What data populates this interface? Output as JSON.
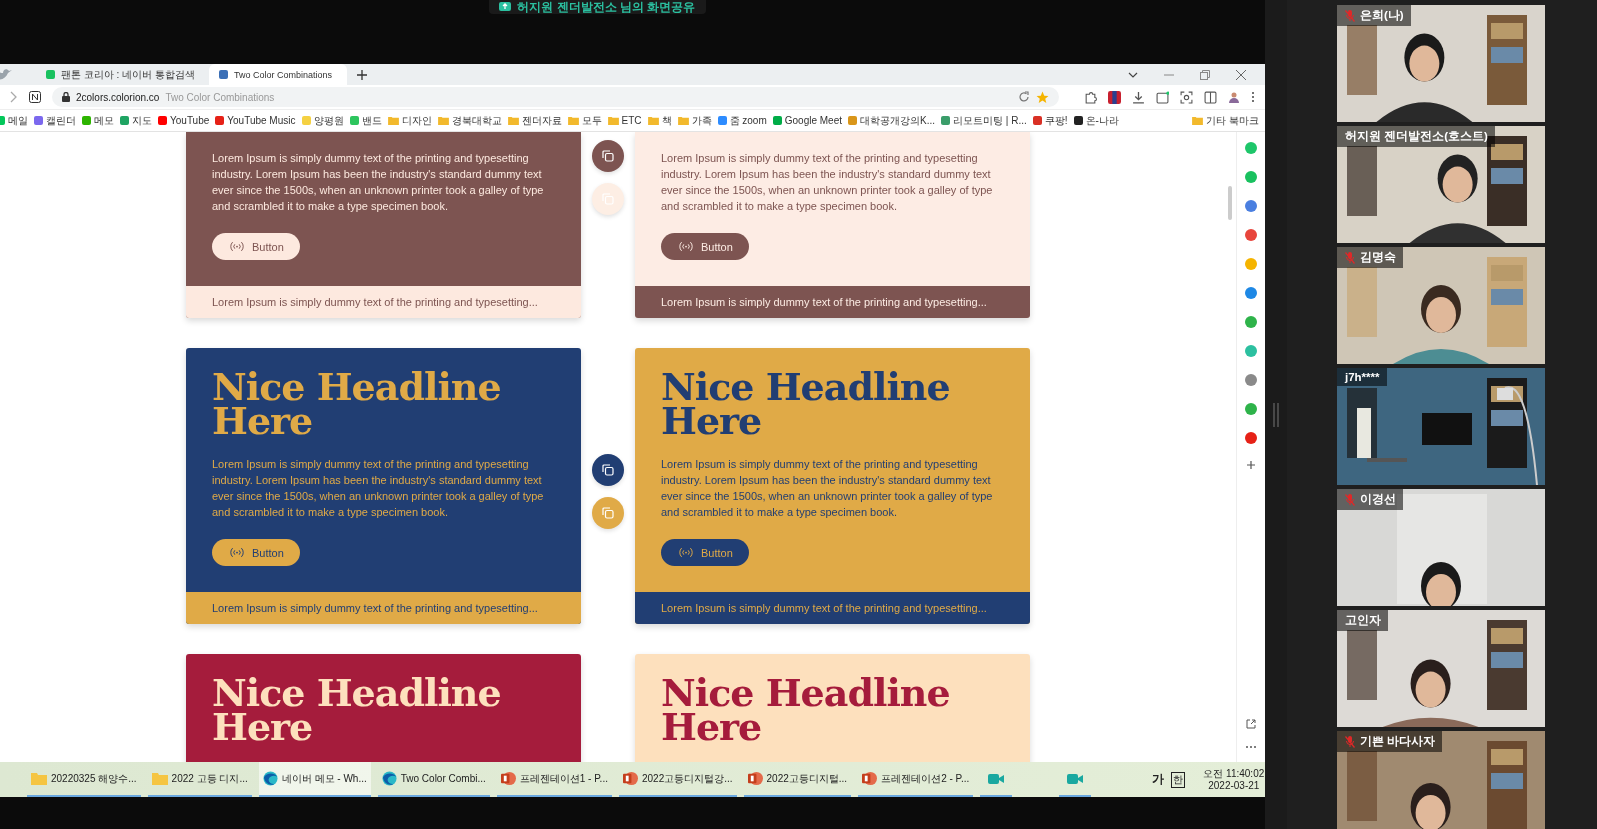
{
  "share_banner": {
    "text": "허지원 젠더발전소 님의 화면공유"
  },
  "browser": {
    "tabs": [
      {
        "title": "팬톤 코리아 : 네이버 통합검색",
        "selected": false,
        "color": "#19c15f"
      },
      {
        "title": "Two Color Combinations",
        "selected": true,
        "color": "#3b6fb6"
      }
    ],
    "address": {
      "domain": "2colors.colorion.co",
      "page_title": "Two Color Combinations"
    },
    "bookmarks": [
      {
        "label": "메일",
        "kind": "site",
        "color": "#03c75a"
      },
      {
        "label": "캘린더",
        "kind": "site",
        "color": "#7b68ee"
      },
      {
        "label": "메모",
        "kind": "site",
        "color": "#2db400"
      },
      {
        "label": "지도",
        "kind": "site",
        "color": "#1fa463"
      },
      {
        "label": "YouTube",
        "kind": "site",
        "color": "#ff0000"
      },
      {
        "label": "YouTube Music",
        "kind": "site",
        "color": "#e62117"
      },
      {
        "label": "양평원",
        "kind": "site",
        "color": "#f5d142"
      },
      {
        "label": "밴드",
        "kind": "site",
        "color": "#2dc55e"
      },
      {
        "label": "디자인",
        "kind": "folder"
      },
      {
        "label": "경북대학교",
        "kind": "folder"
      },
      {
        "label": "젠더자료",
        "kind": "folder"
      },
      {
        "label": "모두",
        "kind": "folder"
      },
      {
        "label": "ETC",
        "kind": "folder"
      },
      {
        "label": "책",
        "kind": "folder"
      },
      {
        "label": "가족",
        "kind": "folder"
      },
      {
        "label": "줌 zoom",
        "kind": "site",
        "color": "#2d8cff"
      },
      {
        "label": "Google Meet",
        "kind": "site",
        "color": "#00ac47"
      },
      {
        "label": "대학공개강의K...",
        "kind": "site",
        "color": "#d9961a"
      },
      {
        "label": "리모트미팅 | R...",
        "kind": "site",
        "color": "#3a9d6a"
      },
      {
        "label": "쿠팡!",
        "kind": "site",
        "color": "#d93025"
      },
      {
        "label": "온-나라",
        "kind": "site",
        "color": "#222222"
      }
    ],
    "other_bookmarks": "기타 북마크"
  },
  "page": {
    "rows": [
      {
        "swatches": [
          {
            "color": "#7d5451"
          },
          {
            "color": "#fdeee4"
          }
        ],
        "cards": [
          {
            "color": "#7d5451",
            "accent": {
              "color": "#fde9df"
            },
            "body": "Lorem Ipsum is simply dummy text of the printing and typesetting industry. Lorem Ipsum has been the industry's standard dummy text ever since the 1500s, when an unknown printer took a galley of type and scrambled it to make a type specimen book.",
            "button": "Button",
            "footer": "Lorem Ipsum is simply dummy text of the printing and typesetting..."
          },
          {
            "color": "#fdece4",
            "accent": {
              "color": "#7d5451"
            },
            "body": "Lorem Ipsum is simply dummy text of the printing and typesetting industry. Lorem Ipsum has been the industry's standard dummy text ever since the 1500s, when an unknown printer took a galley of type and scrambled it to make a type specimen book.",
            "button": "Button",
            "footer": "Lorem Ipsum is simply dummy text of the printing and typesetting..."
          }
        ]
      },
      {
        "swatches": [
          {
            "color": "#213e73"
          },
          {
            "color": "#e0aa47"
          }
        ],
        "cards": [
          {
            "color": "#213e73",
            "accent": {
              "color": "#e0aa47"
            },
            "headline": "Nice Headline Here",
            "body": "Lorem Ipsum is simply dummy text of the printing and typesetting industry. Lorem Ipsum has been the industry's standard dummy text ever since the 1500s, when an unknown printer took a galley of type and scrambled it to make a type specimen book.",
            "button": "Button",
            "footer": "Lorem Ipsum is simply dummy text of the printing and typesetting..."
          },
          {
            "color": "#e0aa47",
            "accent": {
              "color": "#213e73"
            },
            "headline": "Nice Headline Here",
            "body": "Lorem Ipsum is simply dummy text of the printing and typesetting industry. Lorem Ipsum has been the industry's standard dummy text ever since the 1500s, when an unknown printer took a galley of type and scrambled it to make a type specimen book.",
            "button": "Button",
            "footer": "Lorem Ipsum is simply dummy text of the printing and typesetting..."
          }
        ]
      },
      {
        "cards": [
          {
            "color": "#a51c3c",
            "accent": {
              "color": "#fde0bd"
            },
            "headline": "Nice Headline Here"
          },
          {
            "color": "#fde0bd",
            "accent": {
              "color": "#a51c3c"
            },
            "headline": "Nice Headline Here"
          }
        ]
      }
    ]
  },
  "extensions": [
    {
      "color": "#1ec66a"
    },
    {
      "color": "#19c15f"
    },
    {
      "color": "#4a7fe0"
    },
    {
      "color": "#e8453c"
    },
    {
      "color": "#f5b400"
    },
    {
      "color": "#1e88e5"
    },
    {
      "color": "#2eb34a"
    },
    {
      "color": "#2cc0a0"
    },
    {
      "color": "#8a8a8a"
    },
    {
      "color": "#2eb34a"
    },
    {
      "color": "#e62117"
    }
  ],
  "taskbar": {
    "items": [
      {
        "label": "20220325 해양수...",
        "kind": "folder",
        "selected": false
      },
      {
        "label": "2022  고등 디지...",
        "kind": "folder",
        "selected": false
      },
      {
        "label": "네이버 메모 - Wh...",
        "kind": "browser",
        "selected": true
      },
      {
        "label": "Two Color Combi...",
        "kind": "browser",
        "selected": false
      },
      {
        "label": "프레젠테이션1 - P...",
        "kind": "slides",
        "selected": false
      },
      {
        "label": "2022고등디지털강...",
        "kind": "slides",
        "selected": false
      },
      {
        "label": "2022고등디지털...",
        "kind": "slides",
        "selected": false
      },
      {
        "label": "프레젠테이션2 - P...",
        "kind": "slides",
        "selected": false
      },
      {
        "kind": "camera",
        "selected": false
      },
      {
        "kind": "camera",
        "selected": false
      }
    ],
    "ime": "가",
    "ime_mode": "한",
    "time": "오전 11:40:02",
    "date": "2022-03-21"
  },
  "participants": [
    {
      "name": "은희(나)",
      "muted": true
    },
    {
      "name": "허지원 젠더발전소(호스트)",
      "muted": false
    },
    {
      "name": "김명숙",
      "muted": true
    },
    {
      "name": "j7h****",
      "muted": false
    },
    {
      "name": "이경선",
      "muted": true
    },
    {
      "name": "고인자",
      "muted": false
    },
    {
      "name": "기쁜 바다사자",
      "muted": true
    }
  ]
}
